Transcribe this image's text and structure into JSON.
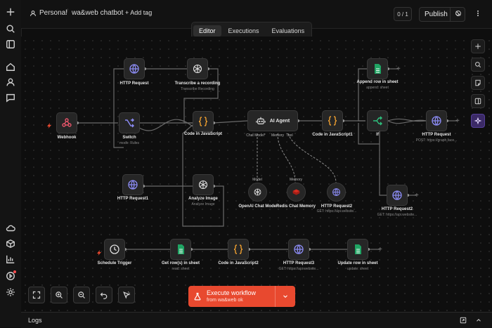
{
  "header": {
    "project": "Personal",
    "separator": "/",
    "workflow_name": "wa&web chatbot",
    "add_tag": "+ Add tag",
    "version": "0 / 1",
    "publish": "Publish"
  },
  "tabs": [
    "Editor",
    "Executions",
    "Evaluations"
  ],
  "nodes": {
    "webhook": {
      "title": "Webhook"
    },
    "http_request": {
      "title": "HTTP Request"
    },
    "transcribe": {
      "title": "Transcribe a recording",
      "sub": "Transcribe Recording"
    },
    "switch": {
      "title": "Switch",
      "sub": "mode: Rules"
    },
    "code1": {
      "title": "Code in JavaScript"
    },
    "ai_agent": {
      "title": "AI Agent",
      "in1": "Chat Model*",
      "in2": "Memory",
      "in3": "Tool"
    },
    "code2": {
      "title": "Code in JavaScript1"
    },
    "append_row": {
      "title": "Append row in sheet",
      "sub": "append: sheet"
    },
    "if_node": {
      "title": "If"
    },
    "http_graph": {
      "title": "HTTP Request",
      "sub": "POST: https://graph.face..."
    },
    "http1": {
      "title": "HTTP Request1"
    },
    "analyze": {
      "title": "Analyze Image",
      "sub": "Analyze Image"
    },
    "openai": {
      "title": "OpenAI Chat Model",
      "in": "Model"
    },
    "redis": {
      "title": "Redis Chat Memory",
      "in": "Memory"
    },
    "http2": {
      "title": "HTTP Request2",
      "sub": "GET: https://api.website..."
    },
    "http2b": {
      "title": "HTTP Request2",
      "sub": "GET: https://api.website..."
    },
    "schedule": {
      "title": "Schedule Trigger"
    },
    "get_rows": {
      "title": "Get row(s) in sheet",
      "sub": "read: sheet"
    },
    "code3": {
      "title": "Code in JavaScript2"
    },
    "http3": {
      "title": "HTTP Request3",
      "sub": "GET: https://api.website..."
    },
    "update_row": {
      "title": "Update row in sheet",
      "sub": "update: sheet"
    }
  },
  "execute": {
    "label": "Execute workflow",
    "sub": "from wa&web ok"
  },
  "logs": {
    "label": "Logs"
  },
  "icons": {
    "rail": [
      "plus-icon",
      "search-icon",
      "layout-icon",
      "home-icon",
      "user-icon",
      "chat-icon",
      "cloud-icon",
      "box-icon",
      "chart-icon",
      "play-icon",
      "gear-icon"
    ],
    "right_toolbar": [
      "plus-icon",
      "search-icon",
      "sticky-note-icon",
      "panel-icon",
      "ai-sparkle-icon"
    ],
    "controls": [
      "fit-view-icon",
      "zoom-in-icon",
      "zoom-out-icon",
      "undo-icon",
      "tidy-up-icon"
    ]
  },
  "colors": {
    "accent": "#e8492f",
    "ai": "#55409a",
    "sheet_green": "#1fa463",
    "code_orange": "#f0a030",
    "http_purple": "#7c7cf0",
    "redis_red": "#d82c20"
  }
}
